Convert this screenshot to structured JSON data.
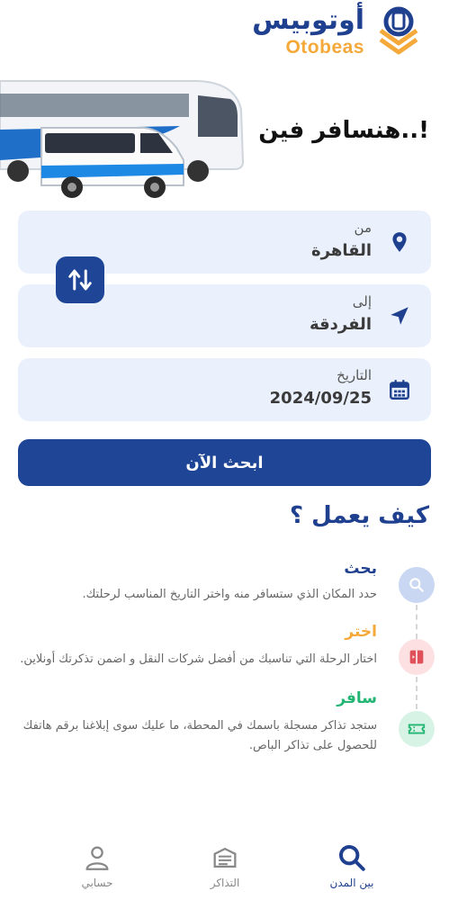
{
  "brand": {
    "name_ar": "أوتوبيس",
    "name_en": "Otobeas"
  },
  "hero": {
    "title": "هنسافر فين..!"
  },
  "form": {
    "from": {
      "label": "من",
      "value": "القاهرة",
      "icon": "location-pin-icon"
    },
    "to": {
      "label": "إلى",
      "value": "الفردقة",
      "icon": "navigation-arrow-icon"
    },
    "date": {
      "label": "التاريخ",
      "value": "2024/09/25",
      "icon": "calendar-icon"
    },
    "swap_icon": "swap-vertical-icon",
    "search_label": "ابحث الآن"
  },
  "how_it_works": {
    "title": "كيف يعمل ؟",
    "steps": [
      {
        "title": "بحث",
        "desc": "حدد المكان الذي ستسافر منه واختر التاريخ المناسب لرحلتك.",
        "color": "#1f3f8f",
        "icon": "search-icon"
      },
      {
        "title": "اختر",
        "desc": "اختار الرحلة التي تناسبك من أفضل شركات النقل و اضمن تذكرتك أونلاين.",
        "color": "#f4a93a",
        "icon": "seat-icon"
      },
      {
        "title": "سافر",
        "desc": "ستجد تذاكر مسجلة باسمك في المحطة، ما عليك سوى إبلاغنا برقم هاتفك للحصول على تذاكر الباص.",
        "color": "#22b573",
        "icon": "ticket-icon"
      }
    ]
  },
  "bottom_nav": {
    "items": [
      {
        "label": "بين المدن",
        "icon": "search-icon",
        "active": true
      },
      {
        "label": "التذاكر",
        "icon": "tickets-icon",
        "active": false
      },
      {
        "label": "حسابي",
        "icon": "user-icon",
        "active": false
      }
    ]
  },
  "colors": {
    "primary": "#1f4596",
    "accent": "#f4a93a",
    "field_bg": "#eaf1fd"
  }
}
